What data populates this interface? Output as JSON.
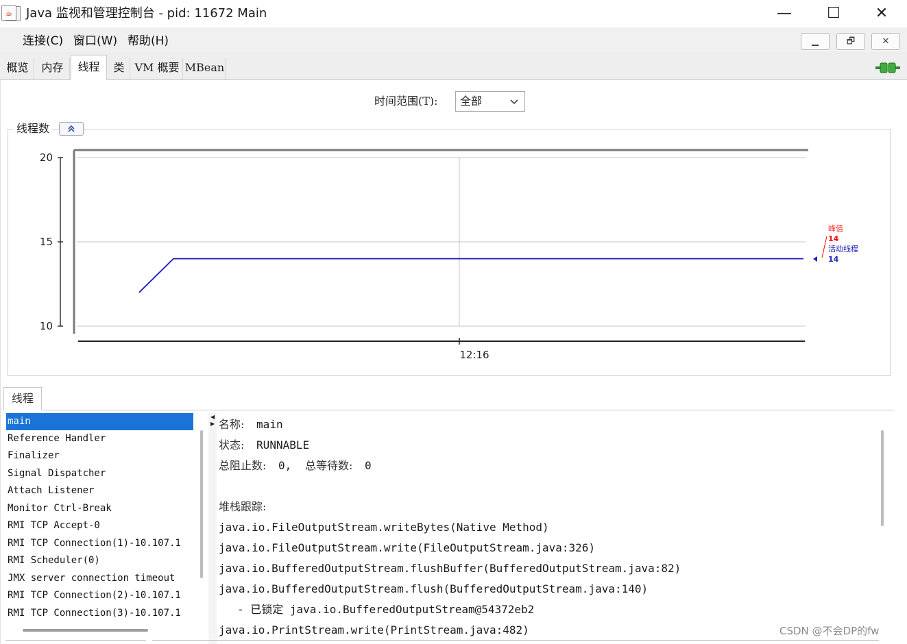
{
  "window": {
    "title": "Java 监视和管理控制台 - pid: 11672 Main",
    "controls": {
      "minimize": "—",
      "maximize": "☐",
      "close": "✕"
    }
  },
  "menubar": {
    "items": [
      "连接(C)",
      "窗口(W)",
      "帮助(H)"
    ],
    "mdi_buttons": {
      "minimize": "▁",
      "restore": "🗗",
      "close": "✕"
    }
  },
  "tabs": [
    {
      "label": "概览",
      "selected": false
    },
    {
      "label": "内存",
      "selected": false
    },
    {
      "label": "线程",
      "selected": true
    },
    {
      "label": "类",
      "selected": false
    },
    {
      "label": "VM 概要",
      "selected": false
    },
    {
      "label": "MBean",
      "selected": false
    }
  ],
  "time_range": {
    "label": "时间范围(T):",
    "value": "全部"
  },
  "chart_panel": {
    "title": "线程数",
    "collapse_icon": "double-chevron-up-icon"
  },
  "chart_data": {
    "type": "line",
    "ylim": [
      10,
      20
    ],
    "yticks": [
      "20",
      "15",
      "10"
    ],
    "xticks": [
      "12:16"
    ],
    "series": [
      {
        "name": "峰值",
        "color": "#ff0000",
        "current": "14",
        "values": [
          12,
          14,
          14,
          14,
          14,
          14
        ]
      },
      {
        "name": "活动线程",
        "color": "#1f1fb4",
        "current": "14",
        "values": [
          12,
          14,
          14,
          14,
          14,
          14
        ]
      }
    ],
    "grid": true
  },
  "threads": {
    "tab_label": "线程",
    "list": [
      "main",
      "Reference Handler",
      "Finalizer",
      "Signal Dispatcher",
      "Attach Listener",
      "Monitor Ctrl-Break",
      "RMI TCP Accept-0",
      "RMI TCP Connection(1)-10.107.1",
      "RMI Scheduler(0)",
      "JMX server connection timeout",
      "RMI TCP Connection(2)-10.107.1",
      "RMI TCP Connection(3)-10.107.1"
    ],
    "selected": "main",
    "detail": {
      "name_label": "名称:",
      "name_value": "main",
      "state_label": "状态:",
      "state_value": "RUNNABLE",
      "blocked_label": "总阻止数:",
      "blocked_value": "0,",
      "waited_label": "总等待数:",
      "waited_value": "0",
      "stack_label": "堆栈跟踪:",
      "stack": [
        "java.io.FileOutputStream.writeBytes(Native Method)",
        "java.io.FileOutputStream.write(FileOutputStream.java:326)",
        "java.io.BufferedOutputStream.flushBuffer(BufferedOutputStream.java:82)",
        "java.io.BufferedOutputStream.flush(BufferedOutputStream.java:140)",
        "- 已锁定 java.io.BufferedOutputStream@54372eb2",
        "java.io.PrintStream.write(PrintStream.java:482)"
      ]
    }
  },
  "watermark": "CSDN @不会DP的fw"
}
